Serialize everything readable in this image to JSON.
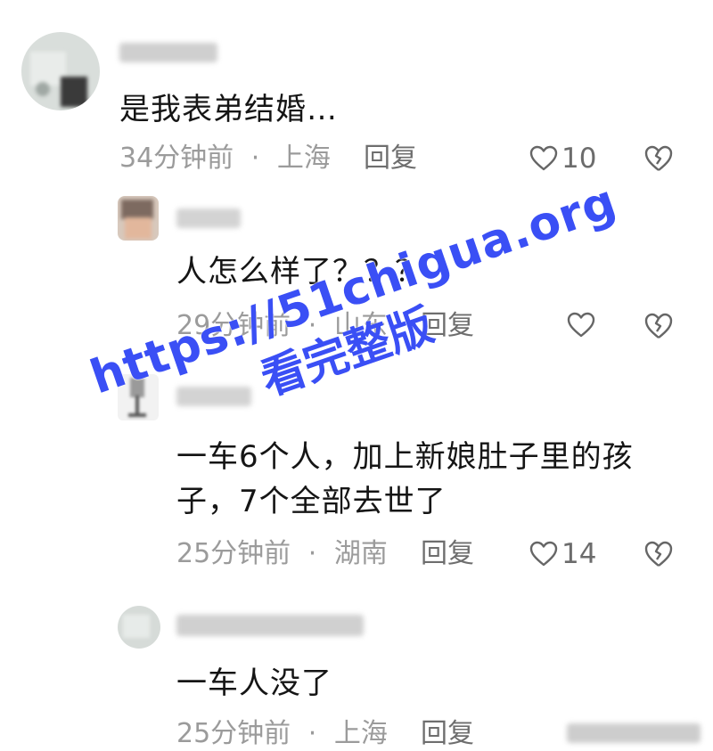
{
  "comments": [
    {
      "content": "是我表弟结婚…",
      "time": "34分钟前",
      "location": "上海",
      "reply_label": "回复",
      "likes": "10"
    },
    {
      "content": "人怎么样了？？？",
      "time": "29分钟前",
      "location": "山东",
      "reply_label": "回复",
      "likes": ""
    },
    {
      "content": "一车6个人，加上新娘肚子里的孩子，7个全部去世了",
      "time": "25分钟前",
      "location": "湖南",
      "reply_label": "回复",
      "likes": "14"
    },
    {
      "content": "一车人没了",
      "time": "25分钟前",
      "location": "上海",
      "reply_label": "回复",
      "likes": ""
    }
  ],
  "separator": "·",
  "watermark": {
    "url": "https://51chigua.org",
    "text": "看完整版"
  },
  "icons": {
    "like": "heart-outline-icon",
    "dislike": "broken-heart-icon"
  },
  "colors": {
    "watermark": "#3a4ff5",
    "meta_text": "#9b9b9b"
  }
}
